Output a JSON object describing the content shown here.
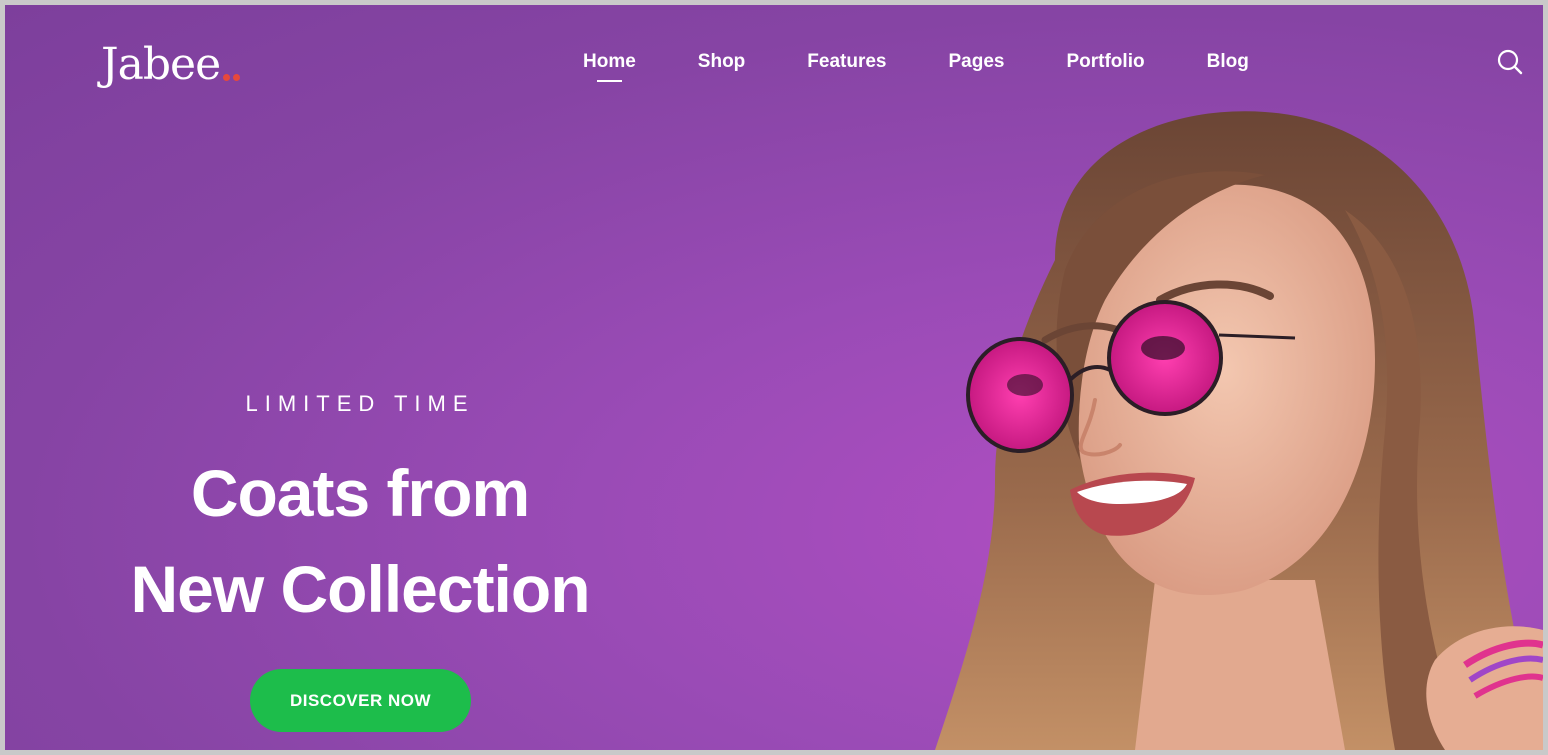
{
  "brand": {
    "name": "Jabee",
    "text_color": "#ffffff",
    "dot_color": "#e8483b"
  },
  "nav": {
    "items": [
      {
        "label": "Home",
        "active": true
      },
      {
        "label": "Shop",
        "active": false
      },
      {
        "label": "Features",
        "active": false
      },
      {
        "label": "Pages",
        "active": false
      },
      {
        "label": "Portfolio",
        "active": false
      },
      {
        "label": "Blog",
        "active": false
      }
    ],
    "search_icon": "search-icon"
  },
  "hero": {
    "eyebrow": "LIMITED TIME",
    "headline_line1": "Coats from",
    "headline_line2": "New Collection",
    "cta_label": "DISCOVER NOW",
    "cta_color": "#1dbd4b",
    "background_color": "#8f46ad",
    "image": "smiling woman with pink round sunglasses"
  }
}
